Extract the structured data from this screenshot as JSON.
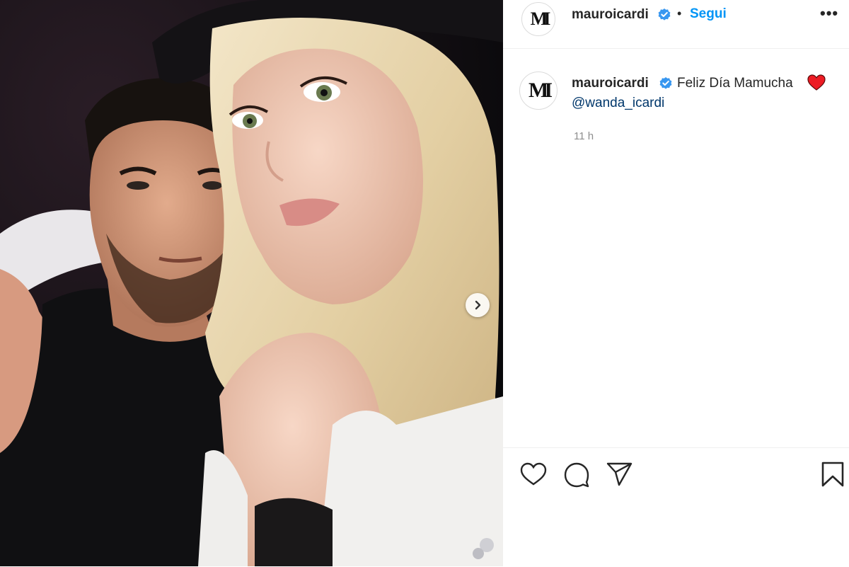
{
  "post": {
    "username": "mauroicardi",
    "avatar_monogram": "MI",
    "dot": "•",
    "follow_label": "Segui",
    "more_label": "•••",
    "caption_text": "Feliz Día Mamucha",
    "mention": "@wanda_icardi",
    "timestamp": "11 h"
  },
  "icons": {
    "verified": "verified-badge-icon",
    "heart_emoji": "red-heart-emoji-icon",
    "next": "chevron-right-icon",
    "like": "heart-outline-icon",
    "comment": "comment-bubble-icon",
    "share": "paper-plane-icon",
    "save": "bookmark-icon"
  },
  "colors": {
    "accent": "#0095f6",
    "verified": "#3897f0",
    "mention": "#00376b",
    "muted": "#8e8e8e",
    "heart": "#ed1c24"
  }
}
